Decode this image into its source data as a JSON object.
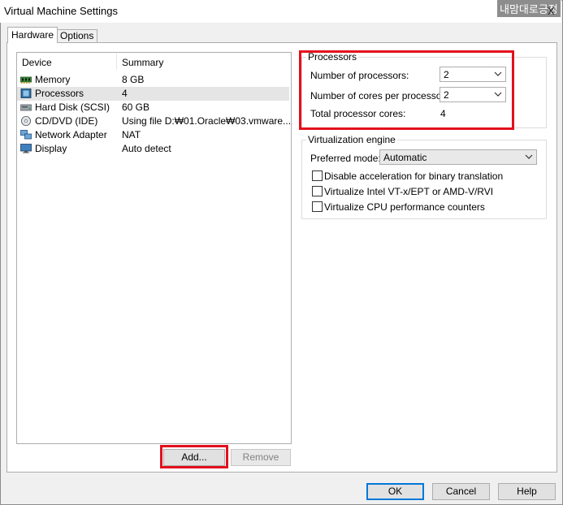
{
  "window": {
    "title": "Virtual Machine Settings",
    "watermark": "내맘대로긍정",
    "close_glyph": "X"
  },
  "tabs": [
    {
      "label": "Hardware",
      "active": true
    },
    {
      "label": "Options",
      "active": false
    }
  ],
  "device_list": {
    "headers": {
      "device": "Device",
      "summary": "Summary"
    },
    "rows": [
      {
        "icon": "memory-icon",
        "device": "Memory",
        "summary": "8 GB"
      },
      {
        "icon": "processor-icon",
        "device": "Processors",
        "summary": "4",
        "selected": true
      },
      {
        "icon": "hard-disk-icon",
        "device": "Hard Disk (SCSI)",
        "summary": "60 GB"
      },
      {
        "icon": "cd-dvd-icon",
        "device": "CD/DVD (IDE)",
        "summary": "Using file D:₩01.Oracle₩03.vmware..."
      },
      {
        "icon": "network-adapter-icon",
        "device": "Network Adapter",
        "summary": "NAT"
      },
      {
        "icon": "display-icon",
        "device": "Display",
        "summary": "Auto detect"
      }
    ]
  },
  "list_buttons": {
    "add": "Add...",
    "remove": "Remove"
  },
  "processors": {
    "title": "Processors",
    "num_processors_label": "Number of processors:",
    "num_processors_value": "2",
    "cores_label": "Number of cores per processor:",
    "cores_value": "2",
    "total_label": "Total processor cores:",
    "total_value": "4"
  },
  "virtualization": {
    "title": "Virtualization engine",
    "preferred_mode_label": "Preferred mode:",
    "preferred_mode_value": "Automatic",
    "options": [
      {
        "label": "Disable acceleration for binary translation",
        "checked": false
      },
      {
        "label": "Virtualize Intel VT-x/EPT or AMD-V/RVI",
        "checked": false
      },
      {
        "label": "Virtualize CPU performance counters",
        "checked": false
      }
    ]
  },
  "footer_buttons": {
    "ok": "OK",
    "cancel": "Cancel",
    "help": "Help"
  },
  "colors": {
    "highlight_box": "#e3101c",
    "default_button_border": "#0078d7",
    "selected_row": "#e5e5e5"
  }
}
